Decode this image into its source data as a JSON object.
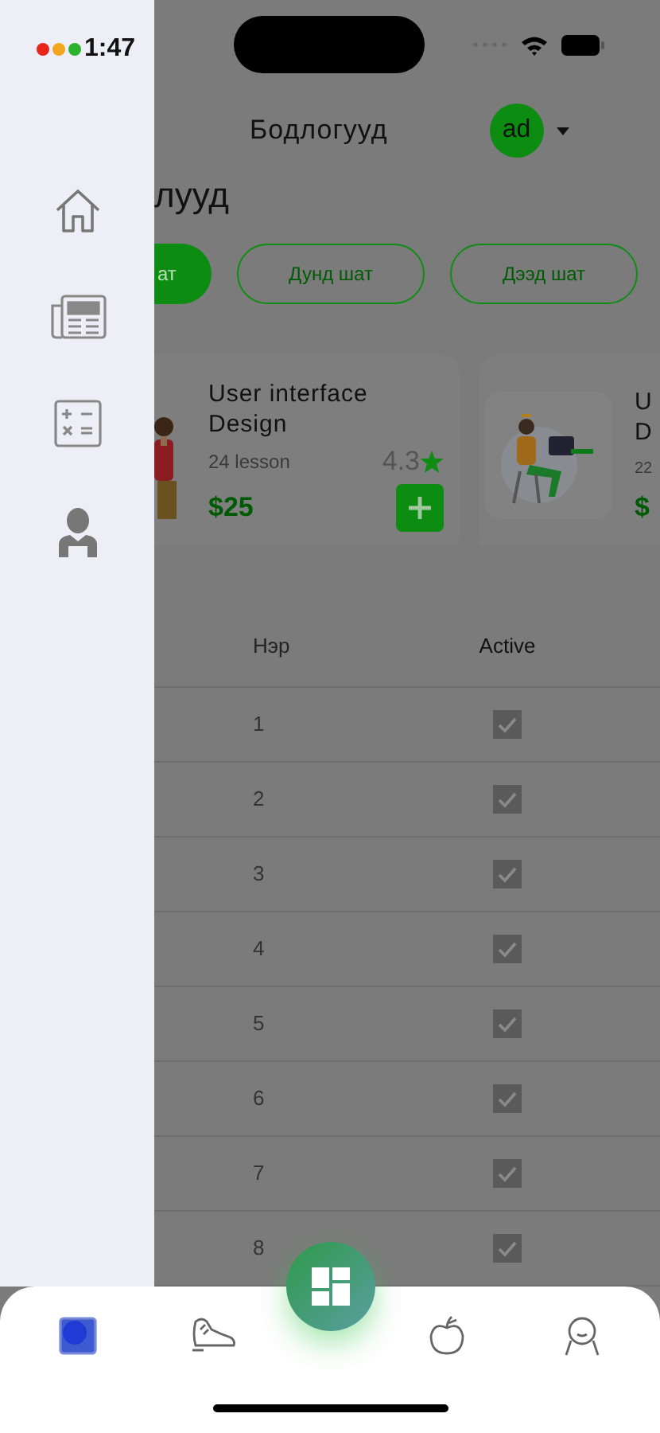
{
  "status_bar": {
    "time": "1:47"
  },
  "header": {
    "title": "Бодлогууд",
    "avatar": "ad"
  },
  "section_title": "лууд",
  "filters": [
    {
      "label": "ат",
      "selected": true
    },
    {
      "label": "Дунд шат",
      "selected": false
    },
    {
      "label": "Дээд шат",
      "selected": false
    }
  ],
  "courses": [
    {
      "title_lines": [
        "User interface",
        "Design"
      ],
      "lessons": "24 lesson",
      "rating": "4.3",
      "price": "$25"
    },
    {
      "title_lines": [
        "U",
        "D"
      ],
      "lessons": "22",
      "price": "$"
    }
  ],
  "table": {
    "columns": [
      "Нэр",
      "Active"
    ],
    "rows": [
      {
        "name": "1",
        "active": true
      },
      {
        "name": "2",
        "active": true
      },
      {
        "name": "3",
        "active": true
      },
      {
        "name": "4",
        "active": true
      },
      {
        "name": "5",
        "active": true
      },
      {
        "name": "6",
        "active": true
      },
      {
        "name": "7",
        "active": true
      },
      {
        "name": "8",
        "active": true
      }
    ]
  },
  "bottom_nav": [
    {
      "selected": true
    },
    {
      "selected": false
    },
    {
      "selected": false
    },
    {
      "selected": false
    }
  ]
}
